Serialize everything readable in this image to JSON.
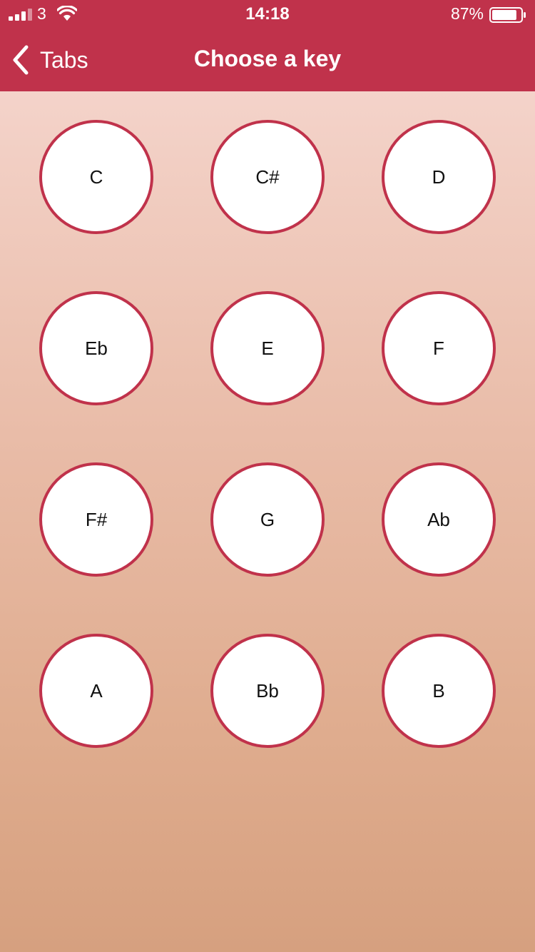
{
  "status_bar": {
    "carrier": "3",
    "time": "14:18",
    "battery_percent": "87%",
    "battery_level": 0.87,
    "icons": [
      "signal-icon",
      "wifi-icon",
      "battery-icon"
    ]
  },
  "nav": {
    "back_label": "Tabs",
    "title": "Choose a key",
    "icons": [
      "chevron-left-icon"
    ]
  },
  "keys": [
    "C",
    "C#",
    "D",
    "Eb",
    "E",
    "F",
    "F#",
    "G",
    "Ab",
    "A",
    "Bb",
    "B"
  ],
  "colors": {
    "accent": "#c0324b",
    "background_top": "#f4d3ca",
    "background_bottom": "#d6a07f",
    "key_fill": "#ffffff"
  }
}
